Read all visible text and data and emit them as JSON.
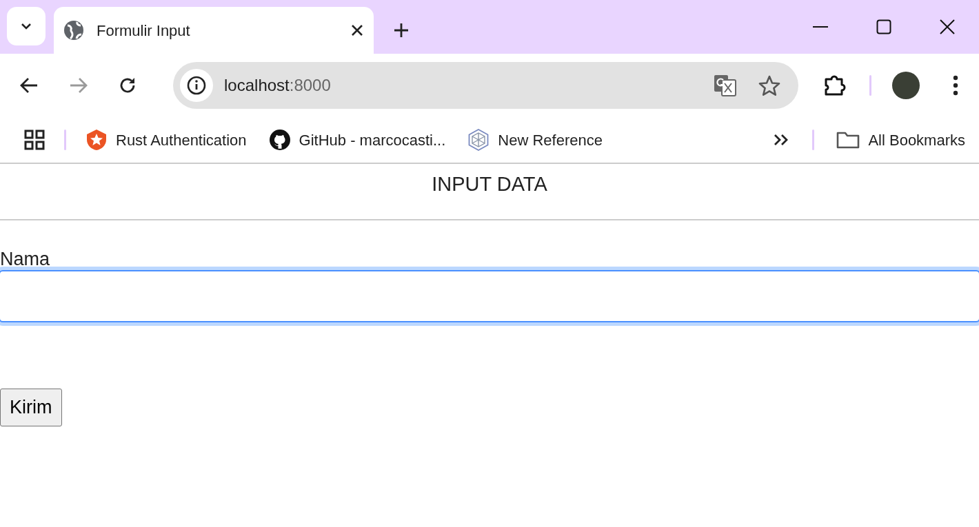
{
  "browser": {
    "tab": {
      "title": "Formulir Input",
      "selected": true
    },
    "address": {
      "host": "localhost",
      "port": ":8000"
    },
    "bookmarks": [
      {
        "kind": "auth",
        "label": "Rust Authentication"
      },
      {
        "kind": "github",
        "label": "GitHub - marcocasti..."
      },
      {
        "kind": "hex",
        "label": "New Reference"
      }
    ],
    "all_bookmarks": "All Bookmarks"
  },
  "page": {
    "heading": "INPUT DATA",
    "form": {
      "label": "Nama",
      "field": {
        "focused": true
      },
      "submit": "Kirim"
    }
  }
}
